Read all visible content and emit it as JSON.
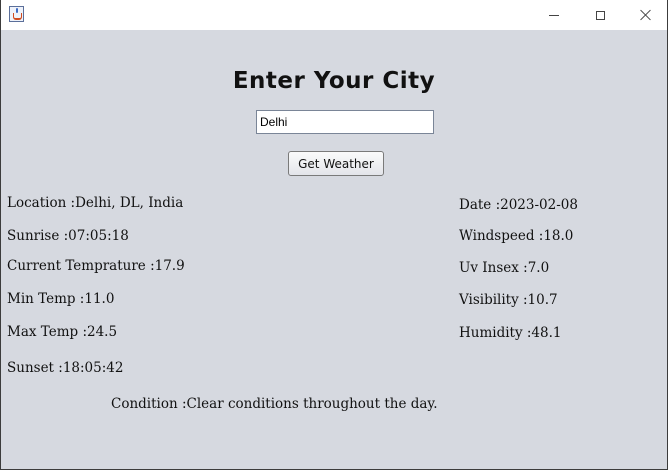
{
  "search": {
    "heading": "Enter Your City",
    "city_value": "Delhi",
    "button_label": "Get Weather"
  },
  "left": {
    "location": "Location :Delhi, DL, India",
    "sunrise": "Sunrise :07:05:18",
    "current_temp": "Current Temprature :17.9",
    "min_temp": "Min Temp :11.0",
    "max_temp": "Max Temp :24.5",
    "sunset": "Sunset :18:05:42"
  },
  "right": {
    "date": "Date :2023-02-08",
    "windspeed": "Windspeed :18.0",
    "uv_index": "Uv Insex :7.0",
    "visibility": "Visibility :10.7",
    "humidity": "Humidity :48.1"
  },
  "condition": "Condition :Clear conditions throughout the day.",
  "colors": {
    "background": "#d6d9e0",
    "titlebar": "#ffffff"
  },
  "icons": {
    "app": "java-cup-icon",
    "minimize": "minimize-icon",
    "maximize": "maximize-icon",
    "close": "close-icon"
  }
}
